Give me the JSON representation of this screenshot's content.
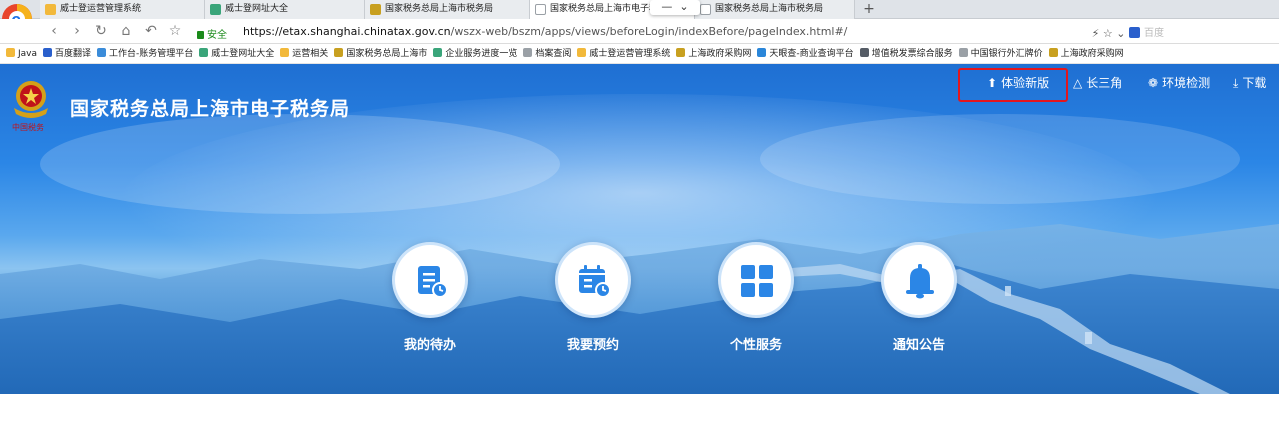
{
  "browser": {
    "tabs": [
      {
        "label": "威士登运营管理系统",
        "icon_color": "#f2b93b"
      },
      {
        "label": "威士登网址大全",
        "icon_color": "#3aa57a"
      },
      {
        "label": "国家税务总局上海市税务局",
        "icon_color": "#c8a020"
      },
      {
        "label": "国家税务总局上海市电子税",
        "icon_color": "#9aa0a6"
      },
      {
        "label": "国家税务总局上海市税务局",
        "icon_color": "#9aa0a6"
      }
    ],
    "new_tab": "+",
    "address": {
      "secure_label": "安全",
      "url_host": "https://etax.shanghai.chinatax.gov.cn",
      "url_path": "/wszx-web/bszm/apps/views/beforeLogin/indexBefore/pageIndex.html#/",
      "search_placeholder": "百度"
    },
    "bookmarks": [
      {
        "label": "Java",
        "icon_color": "#f2b93b"
      },
      {
        "label": "百度翻译",
        "icon_color": "#2a5fcc"
      },
      {
        "label": "工作台-账务管理平台",
        "icon_color": "#3b8cd9"
      },
      {
        "label": "威士登网址大全",
        "icon_color": "#3aa57a"
      },
      {
        "label": "运营相关",
        "icon_color": "#f2b93b"
      },
      {
        "label": "国家税务总局上海市",
        "icon_color": "#c8a020"
      },
      {
        "label": "企业服务进度一览",
        "icon_color": "#3aa57a"
      },
      {
        "label": "档案查阅",
        "icon_color": "#9aa0a6"
      },
      {
        "label": "威士登运营管理系统",
        "icon_color": "#f2b93b"
      },
      {
        "label": "上海政府采购网",
        "icon_color": "#c8a020"
      },
      {
        "label": "天眼查-商业查询平台",
        "icon_color": "#2a86d9"
      },
      {
        "label": "增值税发票综合服务",
        "icon_color": "#555c66"
      },
      {
        "label": "中国银行外汇牌价",
        "icon_color": "#9aa0a6"
      },
      {
        "label": "上海政府采购网",
        "icon_color": "#c8a020"
      }
    ]
  },
  "site": {
    "title": "国家税务总局上海市电子税务局",
    "emblem_caption": "中国税务"
  },
  "topnav": {
    "try_new": "体验新版",
    "yangtze": "长三角",
    "env_check": "环境检测",
    "download": "下载"
  },
  "services": [
    {
      "label": "我的待办",
      "icon": "todo-icon"
    },
    {
      "label": "我要预约",
      "icon": "appointment-icon"
    },
    {
      "label": "个性服务",
      "icon": "apps-grid-icon"
    },
    {
      "label": "通知公告",
      "icon": "bell-icon"
    }
  ],
  "colors": {
    "accent_blue": "#2b86e6",
    "highlight_red": "#e3161d"
  }
}
